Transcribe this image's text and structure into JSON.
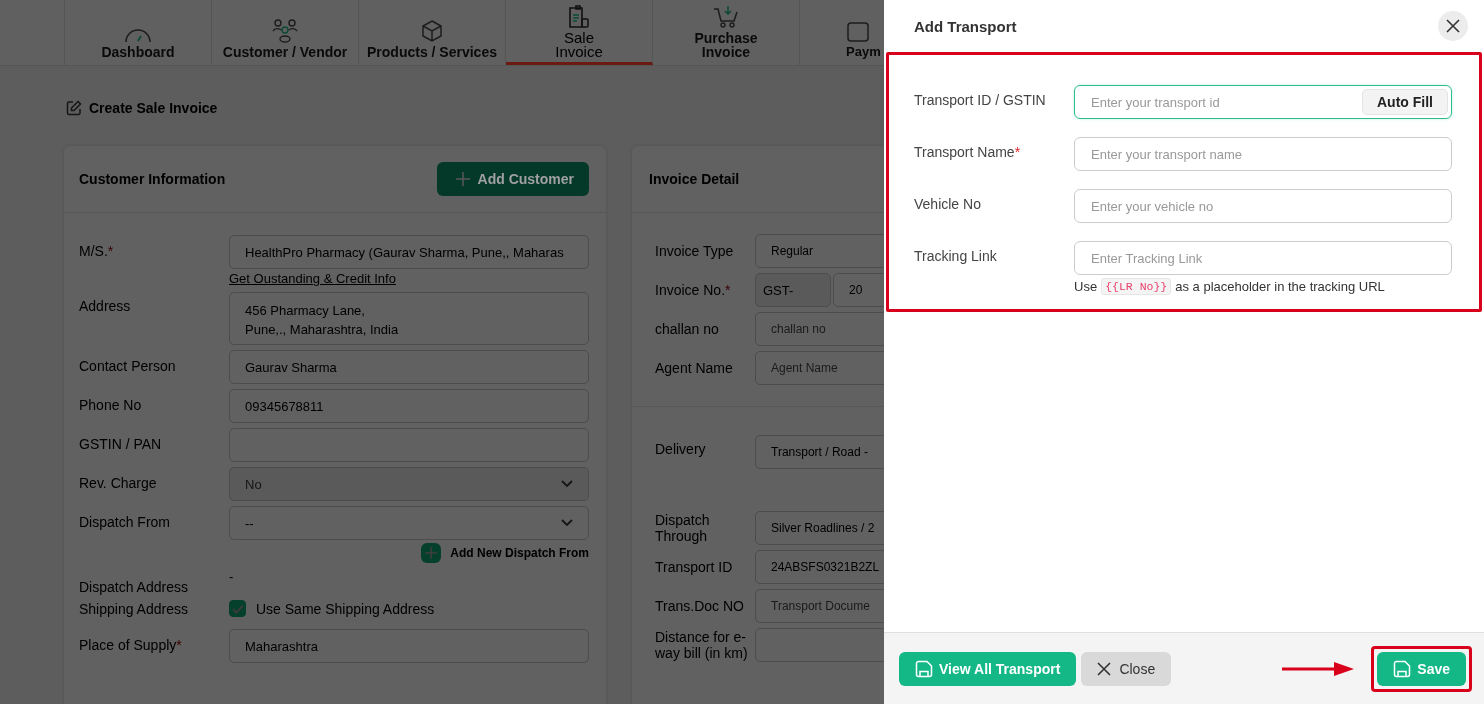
{
  "nav_tabs": [
    {
      "label": "Dashboard",
      "selected": false
    },
    {
      "label": "Customer / Vendor",
      "selected": false
    },
    {
      "label": "Products / Services",
      "selected": false
    },
    {
      "label": "Sale\nInvoice",
      "selected": true
    },
    {
      "label": "Purchase\nInvoice",
      "selected": false
    },
    {
      "label": "Paym",
      "selected": false
    }
  ],
  "page_title": "Create Sale Invoice",
  "customer": {
    "title": "Customer Information",
    "add_button": "Add Customer",
    "fields": [
      {
        "kind": "input",
        "label": "M/S.",
        "required_mark": "*",
        "value": "HealthPro Pharmacy (Gaurav Sharma, Pune,, Maharas"
      },
      {
        "kind": "link",
        "text": "Get Oustanding & Credit Info"
      },
      {
        "kind": "textarea",
        "label": "Address",
        "value": "456 Pharmacy Lane,\nPune,., Maharashtra, India"
      },
      {
        "kind": "input",
        "label": "Contact Person",
        "value": "Gaurav Sharma"
      },
      {
        "kind": "input",
        "label": "Phone No",
        "value": "09345678811"
      },
      {
        "kind": "input",
        "label": "GSTIN / PAN"
      },
      {
        "kind": "select",
        "label": "Rev. Charge",
        "value": "No",
        "disabled": true
      },
      {
        "kind": "select",
        "label": "Dispatch From",
        "value": "--",
        "disabled": false
      },
      {
        "kind": "action",
        "text": "Add New Dispatch From"
      },
      {
        "kind": "static",
        "label": "Dispatch Address",
        "value": "-"
      },
      {
        "kind": "checkbox",
        "label": "Shipping Address",
        "text": "Use Same Shipping Address",
        "checked": true
      },
      {
        "kind": "input",
        "label": "Place of Supply",
        "required_mark": "*",
        "value": "Maharashtra"
      }
    ]
  },
  "invoice": {
    "title": "Invoice Detail",
    "sections": [
      [
        {
          "kind": "input",
          "label": "Invoice Type",
          "value": "Regular"
        },
        {
          "kind": "split",
          "label": "Invoice No.",
          "required_mark": "*",
          "prefix": "GST-",
          "value": "20"
        },
        {
          "kind": "input",
          "label": "challan no",
          "placeholder": "challan no"
        },
        {
          "kind": "input",
          "label": "Agent Name",
          "placeholder": "Agent Name"
        }
      ],
      [
        {
          "kind": "input",
          "label": "Delivery",
          "value": "Transport / Road -"
        },
        {
          "kind": "input",
          "label": "Dispatch Through",
          "value": "Silver Roadlines / 2"
        },
        {
          "kind": "input",
          "label": "Transport ID",
          "value": "24ABSFS0321B2ZL"
        },
        {
          "kind": "input",
          "label": "Trans.Doc NO",
          "placeholder": "Transport Docume"
        },
        {
          "kind": "input",
          "label": "Distance for e-way bill (in km)"
        }
      ]
    ]
  },
  "drawer": {
    "title": "Add Transport",
    "fields": [
      {
        "label": "Transport ID / GSTIN",
        "placeholder": "Enter your transport id",
        "focused": true,
        "button": "Auto Fill"
      },
      {
        "label": "Transport Name",
        "required_mark": "*",
        "placeholder": "Enter your transport name",
        "focused": false
      },
      {
        "label": "Vehicle No",
        "placeholder": "Enter your vehicle no",
        "focused": false
      },
      {
        "label": "Tracking Link",
        "placeholder": "Enter Tracking Link",
        "focused": false,
        "hint": {
          "before": "Use",
          "code": "{{LR No}}",
          "after": "as a placeholder in the tracking URL"
        }
      }
    ],
    "buttons": [
      {
        "kind": "view",
        "label": "View All Transport"
      },
      {
        "kind": "close",
        "label": "Close"
      },
      {
        "kind": "save",
        "label": "Save",
        "highlighted": true
      }
    ]
  }
}
